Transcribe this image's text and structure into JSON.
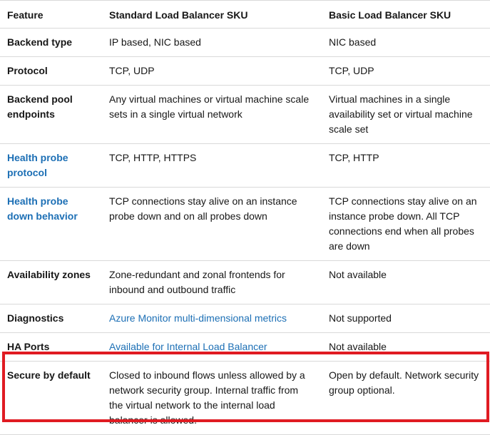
{
  "table": {
    "headers": [
      "Feature",
      "Standard Load Balancer SKU",
      "Basic Load Balancer SKU"
    ],
    "rows": [
      {
        "feature": "Backend type",
        "standard": "IP based, NIC based",
        "basic": "NIC based"
      },
      {
        "feature": "Protocol",
        "standard": "TCP, UDP",
        "basic": "TCP, UDP"
      },
      {
        "feature": "Backend pool endpoints",
        "standard": "Any virtual machines or virtual machine scale sets in a single virtual network",
        "basic": "Virtual machines in a single availability set or virtual machine scale set"
      },
      {
        "feature": "Health probe protocol",
        "standard": "TCP, HTTP, HTTPS",
        "basic": "TCP, HTTP"
      },
      {
        "feature": "Health probe down behavior",
        "standard": "TCP connections stay alive on an instance probe down and on all probes down",
        "basic": "TCP connections stay alive on an instance probe down. All TCP connections end when all probes are down"
      },
      {
        "feature": "Availability zones",
        "standard": "Zone-redundant and zonal frontends for inbound and outbound traffic",
        "basic": "Not available"
      },
      {
        "feature": "Diagnostics",
        "standard": "Azure Monitor multi-dimensional metrics",
        "basic": "Not supported"
      },
      {
        "feature": "HA Ports",
        "standard": "Available for Internal Load Balancer",
        "basic": "Not available"
      },
      {
        "feature": "Secure by default",
        "standard": "Closed to inbound flows unless allowed by a network security group. Internal traffic from the virtual network to the internal load balancer is allowed.",
        "basic": "Open by default. Network security group optional."
      }
    ]
  },
  "colors": {
    "link": "#1c6fb5",
    "highlight": "#e01b22"
  }
}
